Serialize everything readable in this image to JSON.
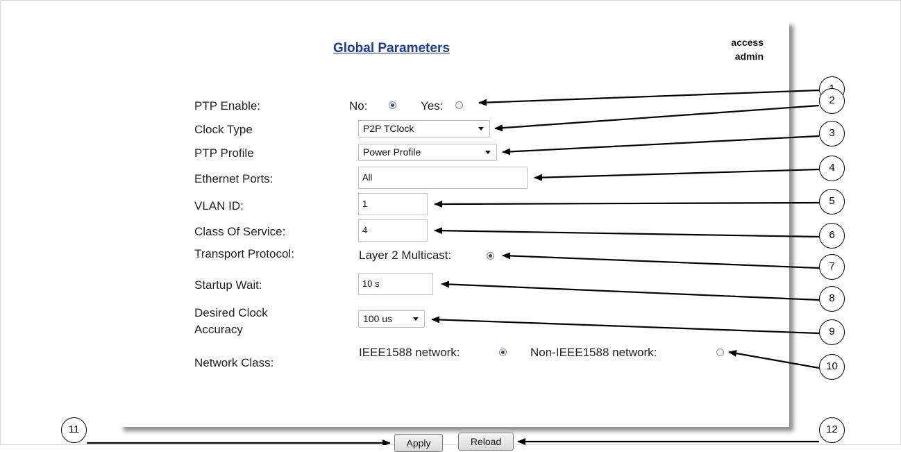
{
  "header": {
    "title": "Global Parameters",
    "access_label": "access",
    "access_value": "admin"
  },
  "fields": {
    "ptp_enable": {
      "label": "PTP Enable:",
      "options": [
        "No:",
        "Yes:"
      ],
      "selected": "No:"
    },
    "clock_type": {
      "label": "Clock Type",
      "value": "P2P TClock"
    },
    "ptp_profile": {
      "label": "PTP Profile",
      "value": "Power Profile"
    },
    "ethernet_ports": {
      "label": "Ethernet Ports:",
      "value": "All"
    },
    "vlan_id": {
      "label": "VLAN ID:",
      "value": "1"
    },
    "class_of_service": {
      "label": "Class Of Service:",
      "value": "4"
    },
    "transport_protocol": {
      "label": "Transport Protocol:",
      "options": [
        "Layer 2 Multicast:"
      ],
      "selected": "Layer 2 Multicast:"
    },
    "startup_wait": {
      "label": "Startup Wait:",
      "value": "10 s"
    },
    "desired_clock_accuracy": {
      "label_line1": "Desired Clock",
      "label_line2": "Accuracy",
      "value": "100 us"
    },
    "network_class": {
      "label": "Network Class:",
      "options": [
        "IEEE1588 network:",
        "Non-IEEE1588 network:"
      ],
      "selected": "IEEE1588 network:"
    }
  },
  "buttons": {
    "apply": "Apply",
    "reload": "Reload"
  },
  "callouts": [
    "1",
    "2",
    "3",
    "4",
    "5",
    "6",
    "7",
    "8",
    "9",
    "10",
    "11",
    "12"
  ]
}
